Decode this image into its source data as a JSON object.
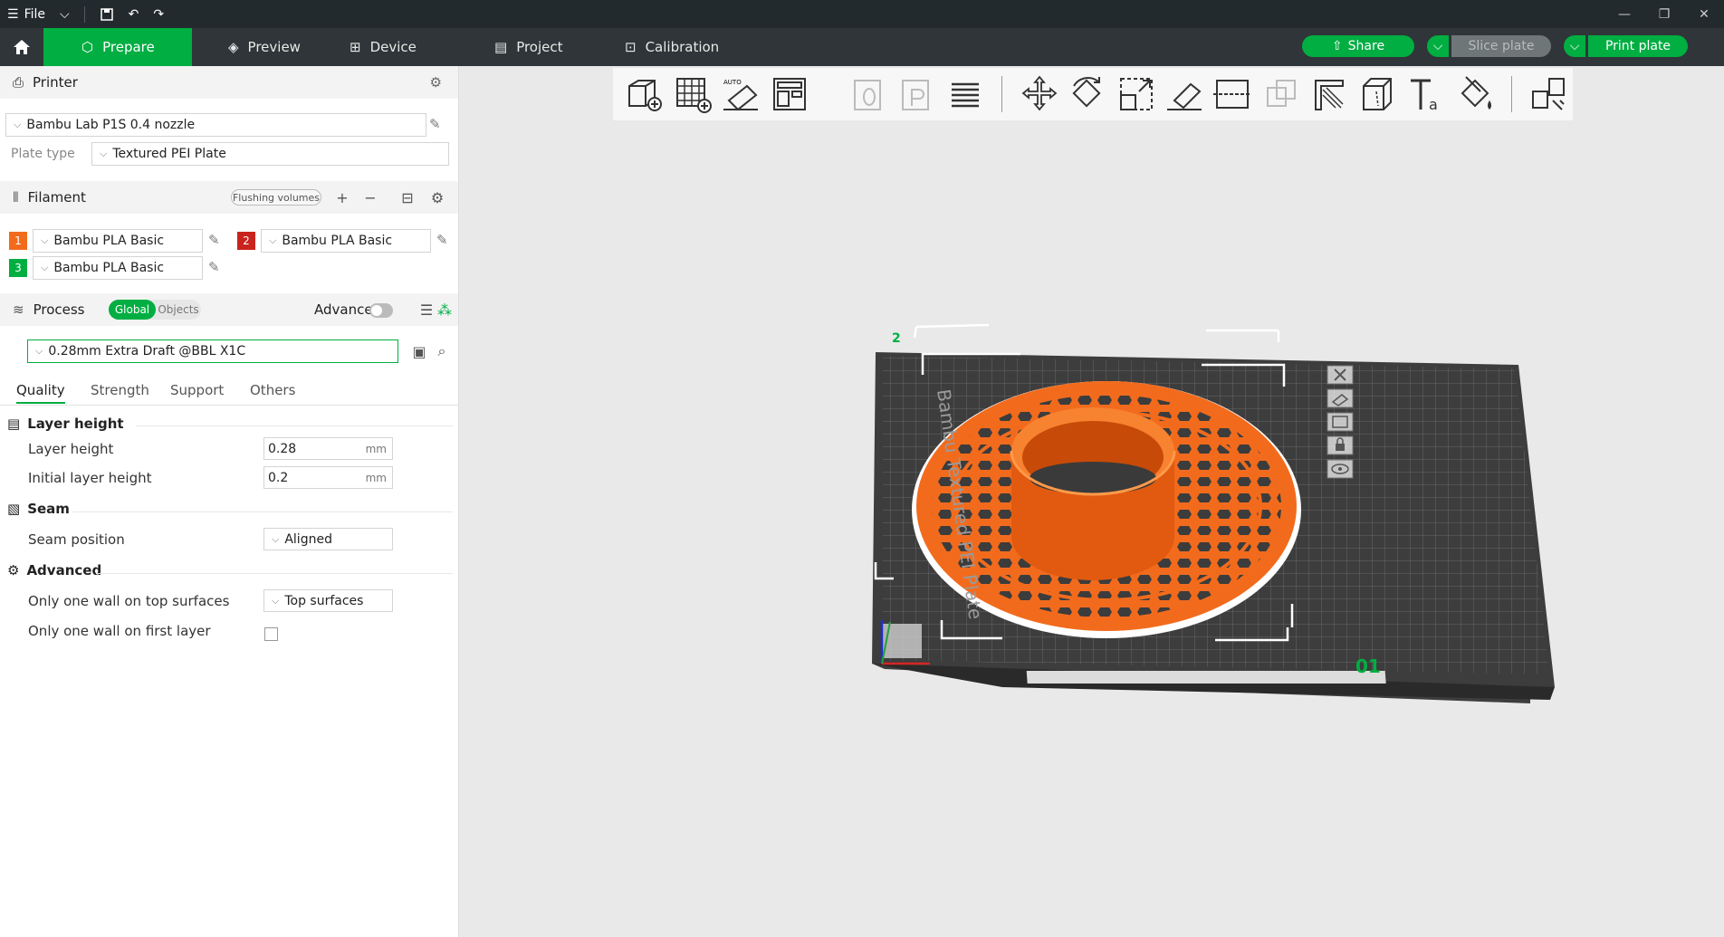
{
  "titlebar": {
    "file_label": "File"
  },
  "nav": {
    "tabs": [
      {
        "label": "Prepare"
      },
      {
        "label": "Preview"
      },
      {
        "label": "Device"
      },
      {
        "label": "Project"
      },
      {
        "label": "Calibration"
      }
    ],
    "share_label": "Share",
    "slice_label": "Slice plate",
    "print_label": "Print plate"
  },
  "printer": {
    "section_label": "Printer",
    "selected": "Bambu Lab P1S 0.4 nozzle",
    "plate_type_label": "Plate type",
    "plate_type": "Textured PEI Plate"
  },
  "filament": {
    "section_label": "Filament",
    "flushing_label": "Flushing volumes",
    "items": [
      {
        "index": "1",
        "name": "Bambu PLA Basic",
        "color": "#f26b1d"
      },
      {
        "index": "2",
        "name": "Bambu PLA Basic",
        "color": "#c8241d"
      },
      {
        "index": "3",
        "name": "Bambu PLA Basic",
        "color": "#00ae42"
      }
    ]
  },
  "process": {
    "section_label": "Process",
    "global_label": "Global",
    "objects_label": "Objects",
    "advance_label": "Advance",
    "preset": "0.28mm Extra Draft @BBL X1C",
    "tabs": [
      "Quality",
      "Strength",
      "Support",
      "Others"
    ],
    "groups": {
      "layer_height": {
        "title": "Layer height",
        "layer_height_label": "Layer height",
        "layer_height_value": "0.28",
        "initial_layer_label": "Initial layer height",
        "initial_layer_value": "0.2",
        "unit": "mm"
      },
      "seam": {
        "title": "Seam",
        "seam_position_label": "Seam position",
        "seam_position_value": "Aligned"
      },
      "advanced": {
        "title": "Advanced",
        "top_wall_label": "Only one wall on top surfaces",
        "top_wall_value": "Top surfaces",
        "first_layer_label": "Only one wall on first layer"
      }
    }
  },
  "viewport": {
    "plate_text": "Bambu Textured PEI Plate",
    "plate_number": "01",
    "plate_edge_number": "2",
    "accent": "#00ae42",
    "model_color": "#f26b1d"
  }
}
